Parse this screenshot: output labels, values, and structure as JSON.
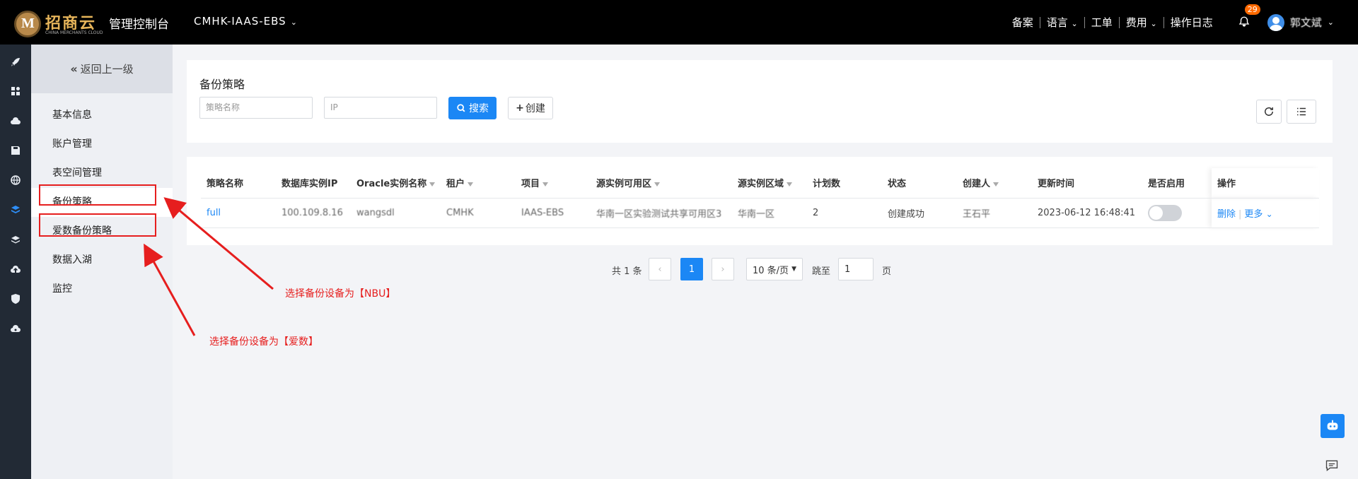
{
  "header": {
    "logo_text": "招商云",
    "logo_sub": "CHINA MERCHANTS CLOUD",
    "console_title": "管理控制台",
    "project": "CMHK-IAAS-EBS",
    "nav": [
      "备案",
      "语言",
      "工单",
      "费用",
      "操作日志"
    ],
    "notification_count": "29",
    "username": "郭文斌"
  },
  "rail_icons": [
    "rocket-icon",
    "grid-icon",
    "cloud-icon",
    "disk-icon",
    "globe-icon",
    "database-icon",
    "layers-icon",
    "cloud-upload-icon",
    "shield-icon",
    "cloud-settings-icon"
  ],
  "submenu": {
    "back_label": "返回上一级",
    "items": [
      "基本信息",
      "账户管理",
      "表空间管理",
      "备份策略",
      "爱数备份策略",
      "数据入湖",
      "监控"
    ]
  },
  "panel": {
    "title": "备份策略",
    "policy_placeholder": "策略名称",
    "ip_placeholder": "IP",
    "search_label": "搜索",
    "create_label": "创建"
  },
  "table": {
    "columns": [
      "策略名称",
      "数据库实例IP",
      "Oracle实例名称",
      "租户",
      "项目",
      "源实例可用区",
      "源实例区域",
      "计划数",
      "状态",
      "创建人",
      "更新时间",
      "是否启用",
      "操作"
    ],
    "rows": [
      {
        "name": "full",
        "ip": "100.109.8.16",
        "instance": "wangsdl",
        "tenant": "CMHK",
        "project": "IAAS-EBS",
        "zone": "华南一区实验测试共享可用区3",
        "region": "华南一区",
        "plans": "2",
        "status": "创建成功",
        "creator": "王石平",
        "updated": "2023-06-12 16:48:41",
        "enabled": false,
        "actions": {
          "delete": "删除",
          "more": "更多"
        }
      }
    ]
  },
  "pagination": {
    "total": "共 1 条",
    "current": "1",
    "page_size": "10 条/页",
    "jump_label": "跳至",
    "jump_value": "1",
    "page_suffix": "页"
  },
  "annotations": {
    "nbu": "选择备份设备为【NBU】",
    "aishu": "选择备份设备为【爱数】"
  },
  "colors": {
    "accent": "#1b87f5",
    "annotation": "#e61e1e",
    "topbar": "#000000",
    "rail": "#222a35"
  }
}
